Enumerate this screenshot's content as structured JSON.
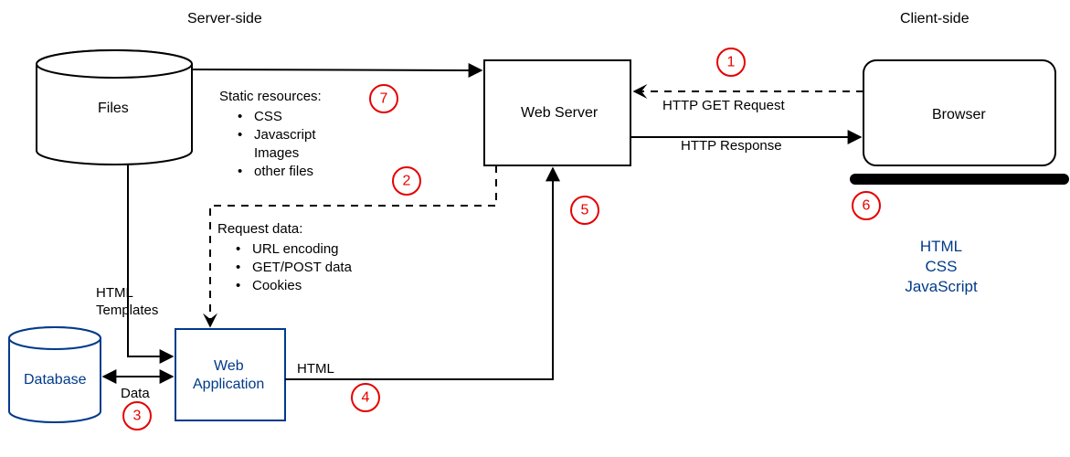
{
  "sections": {
    "server": "Server-side",
    "client": "Client-side"
  },
  "nodes": {
    "files": "Files",
    "database": "Database",
    "webapp_line1": "Web",
    "webapp_line2": "Application",
    "webserver": "Web Server",
    "browser": "Browser"
  },
  "static_resources": {
    "title": "Static resources:",
    "items": [
      "CSS",
      "Javascript",
      "Images",
      "other files"
    ]
  },
  "request_data": {
    "title": "Request data:",
    "items": [
      "URL encoding",
      "GET/POST data",
      "Cookies"
    ]
  },
  "edges": {
    "html_templates_l1": "HTML",
    "html_templates_l2": "Templates",
    "data": "Data",
    "html": "HTML",
    "http_get": "HTTP GET Request",
    "http_response": "HTTP Response"
  },
  "client_tech": [
    "HTML",
    "CSS",
    "JavaScript"
  ],
  "steps": {
    "1": "1",
    "2": "2",
    "3": "3",
    "4": "4",
    "5": "5",
    "6": "6",
    "7": "7"
  },
  "colors": {
    "blue": "#003a8a",
    "red": "#e60000",
    "black": "#000000"
  }
}
